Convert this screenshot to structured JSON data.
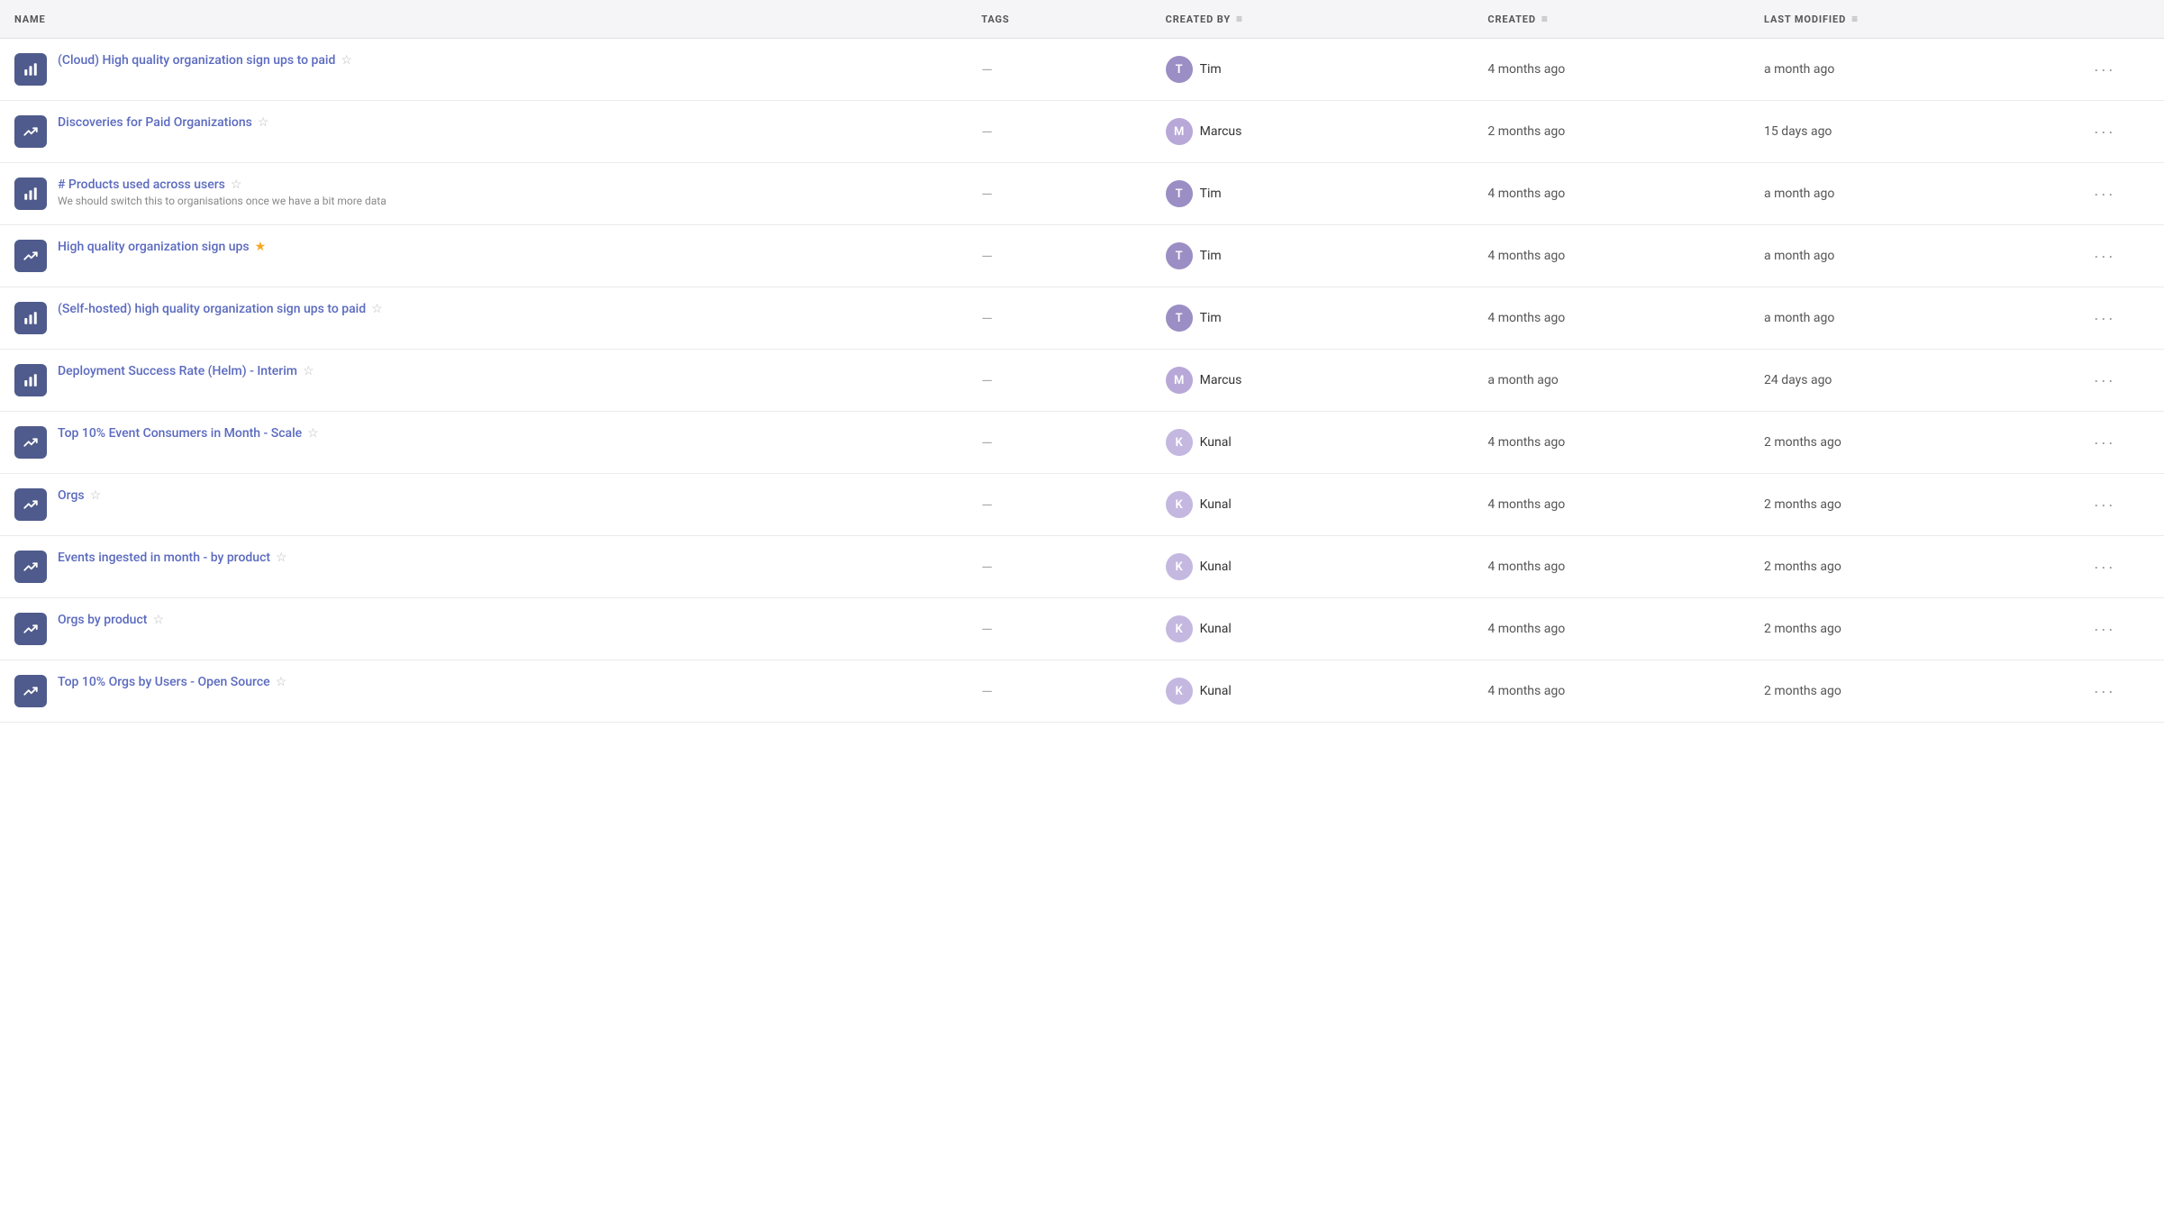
{
  "table": {
    "columns": {
      "name": "NAME",
      "tags": "TAGS",
      "created_by": "CREATED BY",
      "created": "CREATED",
      "last_modified": "LAST MODIFIED"
    },
    "rows": [
      {
        "id": 1,
        "icon": "bar",
        "title": "(Cloud) High quality organization sign ups to paid",
        "description": "",
        "starred": false,
        "tags": "—",
        "created_by_initial": "T",
        "created_by_name": "Tim",
        "created_by_avatar": "avatar-t",
        "created": "4 months ago",
        "last_modified": "a month ago"
      },
      {
        "id": 2,
        "icon": "trend",
        "title": "Discoveries for Paid Organizations",
        "description": "",
        "starred": false,
        "tags": "—",
        "created_by_initial": "M",
        "created_by_name": "Marcus",
        "created_by_avatar": "avatar-m",
        "created": "2 months ago",
        "last_modified": "15 days ago"
      },
      {
        "id": 3,
        "icon": "bar",
        "title": "# Products used across users",
        "description": "We should switch this to organisations once we have a bit more data",
        "starred": false,
        "tags": "—",
        "created_by_initial": "T",
        "created_by_name": "Tim",
        "created_by_avatar": "avatar-t",
        "created": "4 months ago",
        "last_modified": "a month ago"
      },
      {
        "id": 4,
        "icon": "trend",
        "title": "High quality organization sign ups",
        "description": "",
        "starred": true,
        "tags": "—",
        "created_by_initial": "T",
        "created_by_name": "Tim",
        "created_by_avatar": "avatar-t",
        "created": "4 months ago",
        "last_modified": "a month ago"
      },
      {
        "id": 5,
        "icon": "bar",
        "title": "(Self-hosted) high quality organization sign ups to paid",
        "description": "",
        "starred": false,
        "tags": "—",
        "created_by_initial": "T",
        "created_by_name": "Tim",
        "created_by_avatar": "avatar-t",
        "created": "4 months ago",
        "last_modified": "a month ago"
      },
      {
        "id": 6,
        "icon": "bar",
        "title": "Deployment Success Rate (Helm) - Interim",
        "description": "",
        "starred": false,
        "tags": "—",
        "created_by_initial": "M",
        "created_by_name": "Marcus",
        "created_by_avatar": "avatar-m",
        "created": "a month ago",
        "last_modified": "24 days ago"
      },
      {
        "id": 7,
        "icon": "trend",
        "title": "Top 10% Event Consumers in Month - Scale",
        "description": "",
        "starred": false,
        "tags": "—",
        "created_by_initial": "K",
        "created_by_name": "Kunal",
        "created_by_avatar": "avatar-k",
        "created": "4 months ago",
        "last_modified": "2 months ago"
      },
      {
        "id": 8,
        "icon": "trend",
        "title": "Orgs",
        "description": "",
        "starred": false,
        "tags": "—",
        "created_by_initial": "K",
        "created_by_name": "Kunal",
        "created_by_avatar": "avatar-k",
        "created": "4 months ago",
        "last_modified": "2 months ago"
      },
      {
        "id": 9,
        "icon": "trend",
        "title": "Events ingested in month - by product",
        "description": "",
        "starred": false,
        "tags": "—",
        "created_by_initial": "K",
        "created_by_name": "Kunal",
        "created_by_avatar": "avatar-k",
        "created": "4 months ago",
        "last_modified": "2 months ago"
      },
      {
        "id": 10,
        "icon": "trend",
        "title": "Orgs by product",
        "description": "",
        "starred": false,
        "tags": "—",
        "created_by_initial": "K",
        "created_by_name": "Kunal",
        "created_by_avatar": "avatar-k",
        "created": "4 months ago",
        "last_modified": "2 months ago"
      },
      {
        "id": 11,
        "icon": "trend",
        "title": "Top 10% Orgs by Users - Open Source",
        "description": "",
        "starred": false,
        "tags": "—",
        "created_by_initial": "K",
        "created_by_name": "Kunal",
        "created_by_avatar": "avatar-k",
        "created": "4 months ago",
        "last_modified": "2 months ago"
      }
    ]
  }
}
